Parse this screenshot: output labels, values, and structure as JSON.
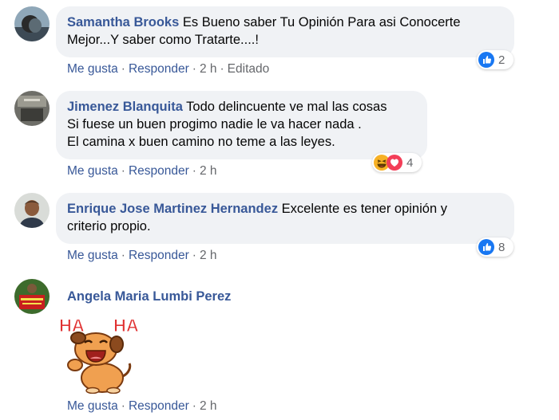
{
  "comments": [
    {
      "author": "Samantha Brooks",
      "text_line1": " Es Bueno saber Tu Opinión Para asi Conocerte",
      "text_line2": "Mejor...Y saber como Tratarte....!",
      "actions": {
        "like": "Me gusta",
        "reply": "Responder",
        "time": "2 h",
        "edited": "Editado"
      },
      "reaction_count": "2"
    },
    {
      "author": "Jimenez Blanquita",
      "text_line1": " Todo delincuente ve mal las cosas",
      "text_line2": "Si fuese un buen progimo nadie le va hacer nada .",
      "text_line3": "El camina x buen camino no teme a las leyes.",
      "actions": {
        "like": "Me gusta",
        "reply": "Responder",
        "time": "2 h"
      },
      "reaction_count": "4"
    },
    {
      "author": "Enrique Jose Martinez Hernandez",
      "text_line1": " Excelente es tener opinión y",
      "text_line2": "criterio propio.",
      "actions": {
        "like": "Me gusta",
        "reply": "Responder",
        "time": "2 h"
      },
      "reaction_count": "8"
    },
    {
      "author": "Angela Maria Lumbi Perez",
      "sticker_text": "HA",
      "actions": {
        "like": "Me gusta",
        "reply": "Responder",
        "time": "2 h"
      }
    }
  ],
  "colors": {
    "link": "#385898",
    "bubble": "#f0f2f5",
    "meta": "#65676b",
    "like_blue": "#1877f2"
  },
  "icons": [
    "like-reaction-icon",
    "haha-reaction-icon",
    "love-reaction-icon"
  ]
}
